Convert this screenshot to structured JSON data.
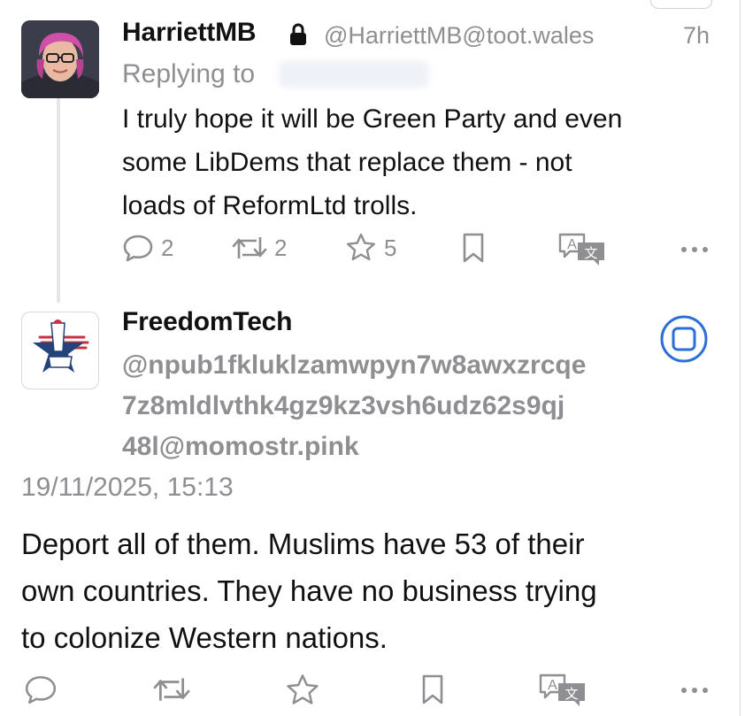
{
  "colors": {
    "text": "#111111",
    "muted": "#8e8e93",
    "accent": "#2b6ed8"
  },
  "post1": {
    "display_name": "HarriettMB",
    "handle": "@HarriettMB@toot.wales",
    "time": "7h",
    "replying_label": "Replying to",
    "content_lines": [
      "I truly hope it will be Green Party and even",
      "some LibDems that replace them - not",
      "loads of ReformLtd trolls."
    ],
    "actions": {
      "reply_count": "2",
      "boost_count": "2",
      "favourite_count": "5"
    },
    "icons": [
      "lock-icon",
      "reply-icon",
      "boost-icon",
      "star-icon",
      "bookmark-icon",
      "translate-icon",
      "more-icon"
    ]
  },
  "post2": {
    "display_name": "FreedomTech",
    "handle_lines": [
      "@npub1fkluklzamwpyn7w8awxzrcqe",
      "7z8mldlvthk4gz9kz3vsh6udz62s9qj",
      "48l@momostr.pink"
    ],
    "timestamp": "19/11/2025, 15:13",
    "content_lines": [
      "Deport all of them.  Muslims have 53 of their",
      "own countries. They have no business trying",
      "to colonize Western nations."
    ],
    "icons": [
      "bot-badge-icon",
      "reply-icon",
      "boost-icon",
      "star-icon",
      "bookmark-icon",
      "translate-icon",
      "more-icon"
    ]
  }
}
